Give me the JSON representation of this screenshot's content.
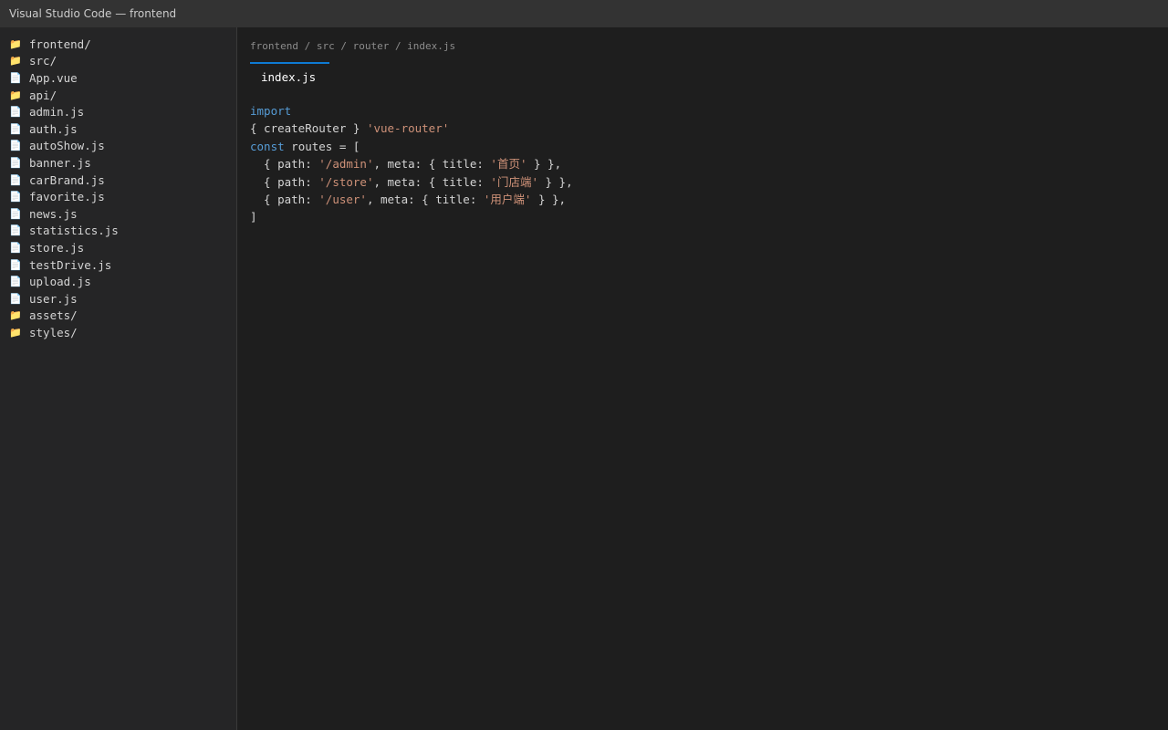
{
  "window": {
    "title": "Visual Studio Code — frontend"
  },
  "sidebar": {
    "items": [
      {
        "type": "folder",
        "label": "frontend/"
      },
      {
        "type": "folder",
        "label": "src/"
      },
      {
        "type": "file",
        "label": "App.vue"
      },
      {
        "type": "folder",
        "label": "api/"
      },
      {
        "type": "file",
        "label": "admin.js"
      },
      {
        "type": "file",
        "label": "auth.js"
      },
      {
        "type": "file",
        "label": "autoShow.js"
      },
      {
        "type": "file",
        "label": "banner.js"
      },
      {
        "type": "file",
        "label": "carBrand.js"
      },
      {
        "type": "file",
        "label": "favorite.js"
      },
      {
        "type": "file",
        "label": "news.js"
      },
      {
        "type": "file",
        "label": "statistics.js"
      },
      {
        "type": "file",
        "label": "store.js"
      },
      {
        "type": "file",
        "label": "testDrive.js"
      },
      {
        "type": "file",
        "label": "upload.js"
      },
      {
        "type": "file",
        "label": "user.js"
      },
      {
        "type": "folder",
        "label": "assets/"
      },
      {
        "type": "folder",
        "label": "styles/"
      }
    ],
    "icons": {
      "folder": "📁",
      "file": "📄"
    }
  },
  "editor": {
    "breadcrumb": "frontend / src / router / index.js",
    "active_tab": "index.js",
    "code": {
      "line1": {
        "keyword": "import"
      },
      "line2": {
        "text": "{ createRouter } ",
        "string": "'vue-router'"
      },
      "line3": {
        "keyword": "const",
        "text": " routes = ["
      },
      "routes": [
        {
          "pre": "  { path: ",
          "path": "'/admin'",
          "mid": ", meta: { title: ",
          "title": "'首页'",
          "post": " } },"
        },
        {
          "pre": "  { path: ",
          "path": "'/store'",
          "mid": ", meta: { title: ",
          "title": "'门店端'",
          "post": " } },"
        },
        {
          "pre": "  { path: ",
          "path": "'/user'",
          "mid": ", meta: { title: ",
          "title": "'用户端'",
          "post": " } },"
        }
      ],
      "closing": "]"
    }
  }
}
